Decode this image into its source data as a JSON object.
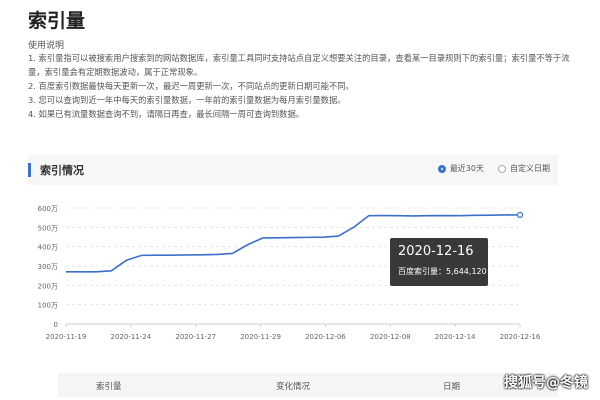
{
  "page": {
    "title": "索引量"
  },
  "usage": {
    "heading": "使用说明",
    "notes": [
      "1. 索引量指可以被搜索用户搜索到的网站数据库，索引量工具同时支持站点自定义想要关注的目录，查看某一目录规则下的索引量；索引量不等于流量，索引量会有定期数据波动，属于正常现象。",
      "2. 百度索引数据最快每天更新一次，最迟一周更新一次，不同站点的更新日期可能不同。",
      "3. 您可以查询到近一年中每天的索引量数据，一年前的索引量数据为每月索引量数据。",
      "4. 如果已有流量数据查询不到，请隔日再查，最长间隔一周可查询到数据。"
    ]
  },
  "panel": {
    "title": "索引情况",
    "radio_recent": "最近30天",
    "radio_custom": "自定义日期"
  },
  "colors": {
    "accent": "#3b73c9",
    "line": "#3a70c9"
  },
  "chart_data": {
    "type": "line",
    "title": "",
    "xlabel": "",
    "ylabel": "",
    "ylim": [
      0,
      6000000
    ],
    "y_ticks": [
      "0",
      "100万",
      "200万",
      "300万",
      "400万",
      "500万",
      "600万"
    ],
    "x_labels": [
      "2020-11-19",
      "2020-11-24",
      "2020-11-27",
      "2020-11-29",
      "2020-12-06",
      "2020-12-08",
      "2020-12-14",
      "2020-12-16"
    ],
    "grid": true,
    "series": [
      {
        "values": [
          2700000,
          2700000,
          2700000,
          2750000,
          3300000,
          3550000,
          3560000,
          3560000,
          3570000,
          3580000,
          3600000,
          3650000,
          4100000,
          4450000,
          4460000,
          4470000,
          4480000,
          4490000,
          4550000,
          5000000,
          5600000,
          5610000,
          5600000,
          5590000,
          5600000,
          5610000,
          5600000,
          5620000,
          5630000,
          5640000,
          5644120
        ]
      }
    ]
  },
  "tooltip": {
    "date": "2020-12-16",
    "value_label": "百度索引量：5,644,120"
  },
  "table": {
    "columns": [
      "索引量",
      "变化情况",
      "日期"
    ]
  },
  "watermark": {
    "text": "搜狐号@冬镜"
  }
}
